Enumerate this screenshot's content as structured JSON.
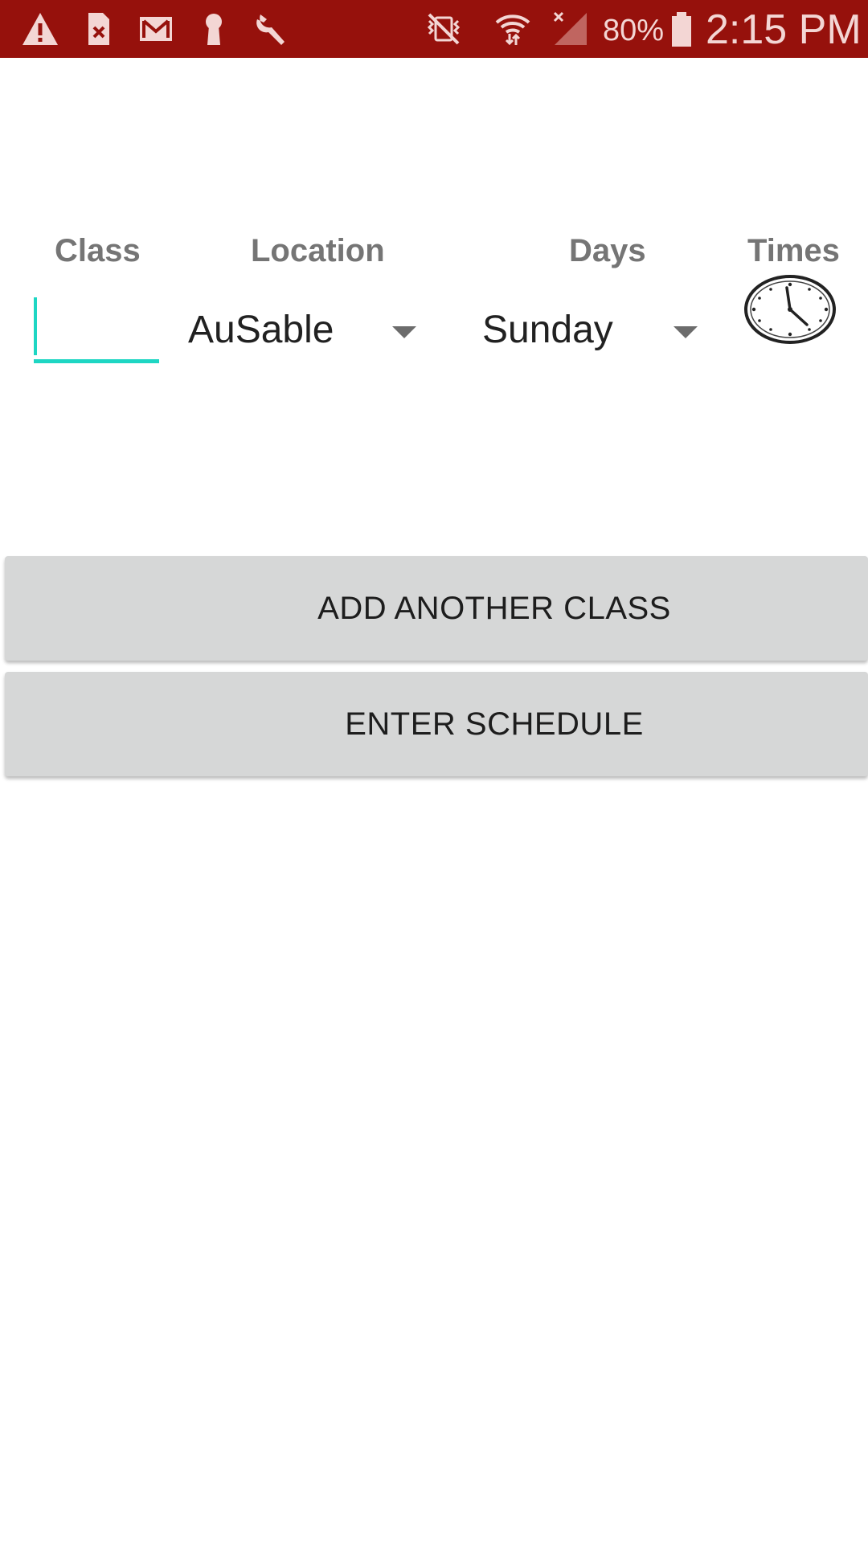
{
  "status_bar": {
    "icons": [
      "warning-icon",
      "sim-error-icon",
      "gmail-icon",
      "keyhole-icon",
      "wrench-icon",
      "vibrate-mute-icon",
      "wifi-icon",
      "signal-icon",
      "battery-icon"
    ],
    "battery_percent": "80%",
    "time": "2:15 PM",
    "background_color": "#96110c"
  },
  "headers": {
    "class": "Class",
    "location": "Location",
    "days": "Days",
    "times": "Times"
  },
  "form": {
    "class_input": {
      "value": "",
      "placeholder": ""
    },
    "location_spinner": {
      "selected": "AuSable"
    },
    "days_spinner": {
      "selected": "Sunday"
    },
    "times_icon": "clock-icon",
    "accent_color": "#1ed6c3"
  },
  "buttons": {
    "add_another_class": "ADD ANOTHER CLASS",
    "enter_schedule": "ENTER SCHEDULE"
  }
}
